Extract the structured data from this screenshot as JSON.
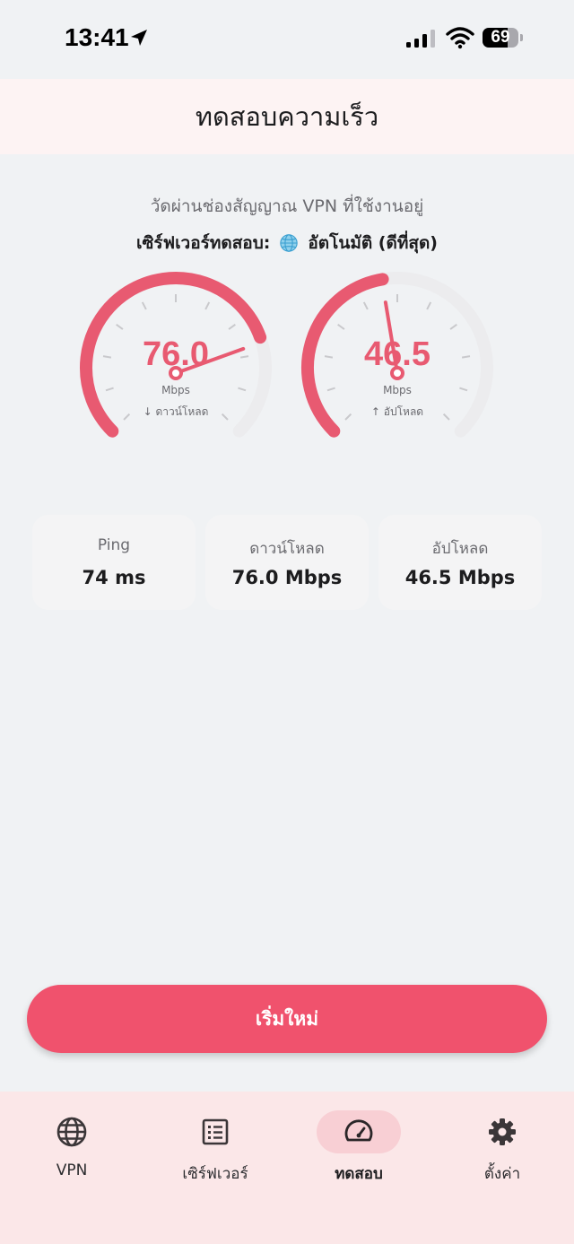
{
  "status": {
    "time": "13:41",
    "battery": "69",
    "battery_level": 0.69
  },
  "header": {
    "title": "ทดสอบความเร็ว"
  },
  "info": {
    "subtitle": "วัดผ่านช่องสัญญาณ VPN ที่ใช้งานอยู่",
    "server_label": "เซิร์ฟเวอร์ทดสอบ:",
    "server_value": "อัตโนมัติ (ดีที่สุด)"
  },
  "gauges": {
    "download": {
      "value": "76.0",
      "unit": "Mbps",
      "label": "↓ ดาวน์โหลด",
      "fraction": 0.76
    },
    "upload": {
      "value": "46.5",
      "unit": "Mbps",
      "label": "↑ อัปโหลด",
      "fraction": 0.465
    }
  },
  "stats": [
    {
      "label": "Ping",
      "value": "74 ms"
    },
    {
      "label": "ดาวน์โหลด",
      "value": "76.0 Mbps"
    },
    {
      "label": "อัปโหลด",
      "value": "46.5 Mbps"
    }
  ],
  "actions": {
    "restart_label": "เริ่มใหม่"
  },
  "nav": {
    "items": [
      {
        "label": "VPN",
        "icon": "globe-icon"
      },
      {
        "label": "เซิร์ฟเวอร์",
        "icon": "list-icon"
      },
      {
        "label": "ทดสอบ",
        "icon": "speedometer-icon",
        "active": true
      },
      {
        "label": "ตั้งค่า",
        "icon": "gear-icon"
      }
    ]
  },
  "colors": {
    "accent": "#f0526d",
    "gauge": "#e85a71",
    "track": "#ececee",
    "nav_bg": "#fbe7e8"
  }
}
